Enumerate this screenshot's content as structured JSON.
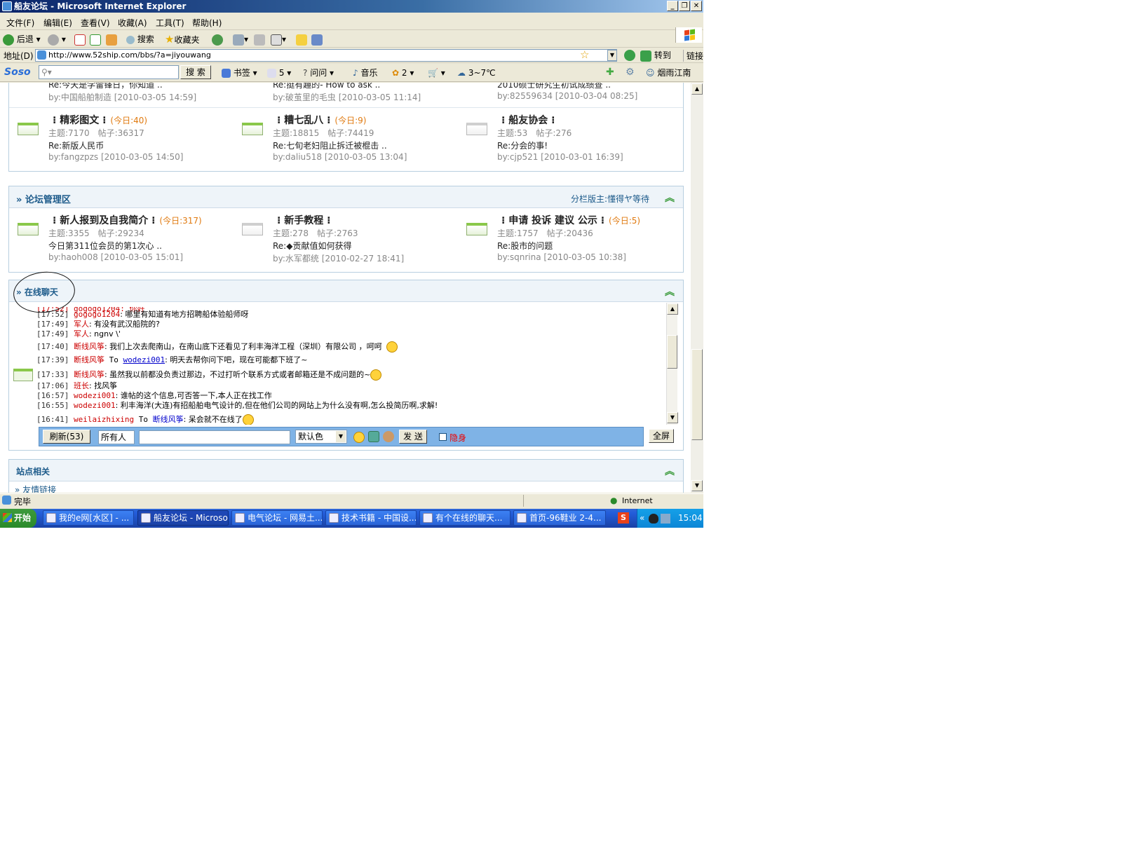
{
  "window": {
    "title": "船友论坛 - Microsoft Internet Explorer"
  },
  "menu": [
    "文件(F)",
    "编辑(E)",
    "查看(V)",
    "收藏(A)",
    "工具(T)",
    "帮助(H)"
  ],
  "toolbar": {
    "back": "后退",
    "search": "搜索",
    "favorites": "收藏夹"
  },
  "address": {
    "label": "地址(D)",
    "url": "http://www.52ship.com/bbs/?a=jiyouwang",
    "go": "转到",
    "links": "链接"
  },
  "soso": {
    "logo": "Soso",
    "search_btn": "搜 索",
    "bookmarks": "书签",
    "mail_count": "5",
    "ask": "问问",
    "music": "音乐",
    "count2": "2",
    "weather": "3~7℃",
    "city": "烟雨江南"
  },
  "top_partial": [
    {
      "reply": "Re:今天是学雷锋日，你知道 ..",
      "by": "by:中国船舶制造",
      "time": "[2010-03-05 14:59]"
    },
    {
      "reply": "Re:挺有趣的- How to ask ..",
      "by": "by:破茧里的毛虫",
      "time": "[2010-03-05 11:14]"
    },
    {
      "reply": "2010硕士研究生初试成绩查 ..",
      "by": "by:82559634",
      "time": "[2010-03-04 08:25]"
    }
  ],
  "forums_row1": [
    {
      "name": "精彩图文",
      "today": "(今日:40)",
      "stats": "主题:7170　帖子:36317",
      "reply": "Re:新版人民币",
      "by": "by:fangzpzs",
      "time": "[2010-03-05 14:50]"
    },
    {
      "name": "糟七乱八",
      "today": "(今日:9)",
      "stats": "主题:18815　帖子:74419",
      "reply": "Re:七旬老妇阻止拆迁被棍击 ..",
      "by": "by:daliu518",
      "time": "[2010-03-05 13:04]"
    },
    {
      "name": "船友协会",
      "today": "",
      "stats": "主题:53　帖子:276",
      "reply": "Re:分会的事!",
      "by": "by:cjp521",
      "time": "[2010-03-01 16:39]"
    }
  ],
  "admin": {
    "title": "» 论坛管理区",
    "moderator": "分栏版主:懂得ヤ等待",
    "forums": [
      {
        "name": "新人报到及自我简介",
        "today": "(今日:317)",
        "stats": "主题:3355　帖子:29234",
        "reply": "今日第311位会员的第1次心 ..",
        "by": "by:haoh008",
        "time": "[2010-03-05 15:01]"
      },
      {
        "name": "新手教程",
        "today": "",
        "stats": "主题:278　帖子:2763",
        "reply": "Re:◆贡献值如何获得",
        "by": "by:水军都统",
        "time": "[2010-02-27 18:41]"
      },
      {
        "name": "申请 投诉 建议 公示",
        "today": "(今日:5)",
        "stats": "主题:1757　帖子:20436",
        "reply": "Re:股市的问题",
        "by": "by:sqnrina",
        "time": "[2010-03-05 10:38]"
      }
    ]
  },
  "chat": {
    "title": "» 在线聊天",
    "messages": [
      {
        "time": "[17:52]",
        "user": "gogogo1204",
        "to": "",
        "text": ": 哪里有知道有地方招聘船体验船师呀"
      },
      {
        "time": "[17:49]",
        "user": "军人",
        "to": "",
        "text": ": 有没有武汉船院的?"
      },
      {
        "time": "[17:49]",
        "user": "军人",
        "to": "",
        "text": ": ngnv \\'"
      },
      {
        "time": "[17:40]",
        "user": "断线风筝",
        "to": "",
        "text": ": 我们上次去爬南山，在南山底下还看见了利丰海洋工程（深圳）有限公司 ，呵呵"
      },
      {
        "time": "[17:39]",
        "user": "断线风筝",
        "to": "wodezi001",
        "text": ": 明天去帮你问下吧，现在可能都下班了~"
      },
      {
        "time": "[17:33]",
        "user": "断线风筝",
        "to": "",
        "text": ": 虽然我以前都没负责过那边，不过打听个联系方式或者邮箱还是不成问题的~"
      },
      {
        "time": "[17:06]",
        "user": "班长",
        "to": "",
        "text": ": 找风筝"
      },
      {
        "time": "[16:57]",
        "user": "wodezi001",
        "to": "",
        "text": ": 谁帖的这个信息,可否答一下,本人正在找工作"
      },
      {
        "time": "[16:55]",
        "user": "wodezi001",
        "to": "",
        "text": ": 利丰海洋(大连)有招船舶电气设计的,但在他们公司的网站上为什么没有啊,怎么投简历啊,求解!"
      },
      {
        "time": "[16:41]",
        "user": "weilaizhixing",
        "to": "断线风筝",
        "text": ": 呆会就不在线了"
      }
    ],
    "to_word": "To",
    "refresh": "刷新(53)",
    "recipient": "所有人",
    "color": "默认色",
    "send": "发 送",
    "hidden": "隐身",
    "fullscreen": "全屏"
  },
  "site": {
    "title": "站点相关",
    "link": "» 友情链接"
  },
  "status": {
    "text": "完毕",
    "zone": "Internet"
  },
  "taskbar": {
    "start": "开始",
    "tasks": [
      "我的e网[水区] - ...",
      "船友论坛 - Microso...",
      "电气论坛 - 网易土...",
      "技术书籍 - 中国设...",
      "有个在线的聊天...",
      "首页-96鞋业 2-4..."
    ],
    "clock": "15:04"
  }
}
